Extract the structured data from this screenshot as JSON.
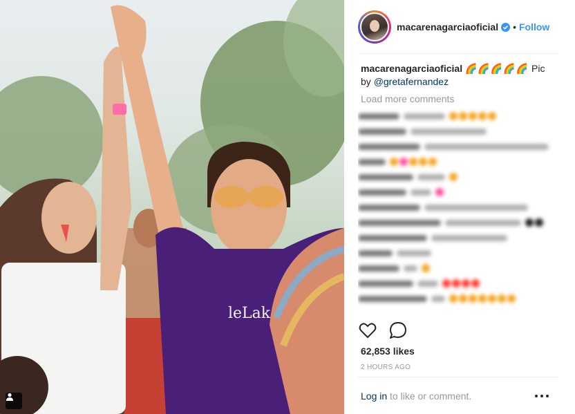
{
  "post": {
    "username": "macarenagarciaoficial",
    "follow_label": "Follow",
    "separator": "•",
    "caption_user": "macarenagarciaoficial",
    "caption_emojis": "🌈🌈🌈🌈🌈",
    "caption_text": " Pic by ",
    "caption_mention": "@gretafernandez",
    "load_more": "Load more comments",
    "likes": "62,853 likes",
    "time_ago": "2 HOURS AGO",
    "login_link": "Log in",
    "login_rest": " to like or comment."
  },
  "comments": [
    {
      "user_w": 60,
      "text_w": 60,
      "emojis": [
        "#f5a623",
        "#f5a623",
        "#f5a623",
        "#f5a623",
        "#f5a623"
      ]
    },
    {
      "user_w": 70,
      "text_w": 110,
      "emojis": []
    },
    {
      "user_w": 90,
      "text_w": 180,
      "emojis": []
    },
    {
      "user_w": 40,
      "text_w": 0,
      "emojis": [
        "#f5a623",
        "#ff4fa3",
        "#f5a623",
        "#f5a623",
        "#f5a623"
      ]
    },
    {
      "user_w": 80,
      "text_w": 40,
      "emojis": [
        "#f5a623"
      ]
    },
    {
      "user_w": 70,
      "text_w": 30,
      "emojis": [
        "#ff4fa3"
      ]
    },
    {
      "user_w": 90,
      "text_w": 150,
      "emojis": []
    },
    {
      "user_w": 120,
      "text_w": 110,
      "emojis": [
        "#222222",
        "#222222"
      ]
    },
    {
      "user_w": 100,
      "text_w": 110,
      "emojis": []
    },
    {
      "user_w": 50,
      "text_w": 50,
      "emojis": []
    },
    {
      "user_w": 60,
      "text_w": 20,
      "emojis": [
        "#f5a623"
      ]
    },
    {
      "user_w": 80,
      "text_w": 30,
      "emojis": [
        "#ff3b30",
        "#ff3b30",
        "#ff3b30",
        "#ff3b30"
      ]
    },
    {
      "user_w": 100,
      "text_w": 20,
      "emojis": [
        "#f5a623",
        "#f5a623",
        "#f5a623",
        "#f5a623",
        "#f5a623",
        "#f5a623",
        "#f5a623"
      ]
    }
  ],
  "icons": {
    "heart": "heart-icon",
    "comment": "comment-icon",
    "more": "more-options-icon",
    "verified": "verified-badge-icon",
    "tag": "user-tag-icon"
  },
  "colors": {
    "link_blue": "#3897f0",
    "mention_blue": "#003569",
    "muted": "#999999",
    "shirt_purple": "#4a1f77"
  }
}
